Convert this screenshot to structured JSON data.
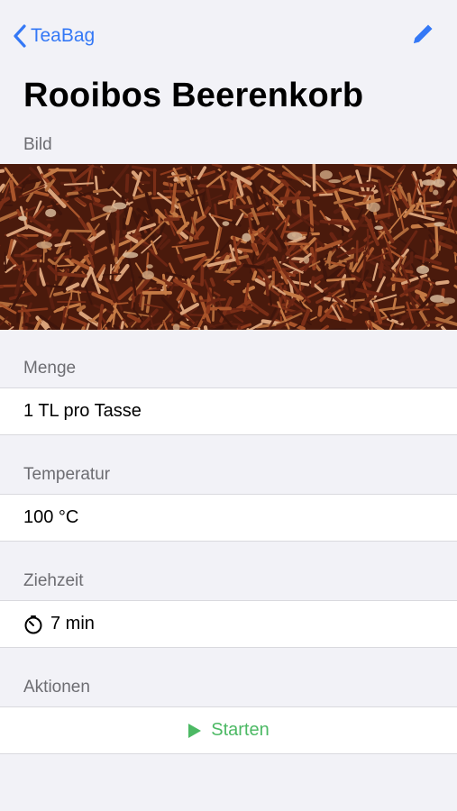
{
  "nav": {
    "back_label": "TeaBag",
    "back_icon": "chevron-left-icon",
    "edit_icon": "pencil-icon"
  },
  "title": "Rooibos Beerenkorb",
  "sections": {
    "image_header": "Bild",
    "amount_header": "Menge",
    "amount_value": "1 TL pro Tasse",
    "temperature_header": "Temperatur",
    "temperature_value": "100 °C",
    "steep_header": "Ziehzeit",
    "steep_value": "7 min",
    "steep_icon": "timer-icon",
    "actions_header": "Aktionen",
    "start_label": "Starten",
    "start_icon": "play-icon"
  },
  "colors": {
    "accent": "#3478f6",
    "start_green": "#4cb964",
    "background": "#f2f2f7",
    "section_header": "#6d6d72"
  }
}
